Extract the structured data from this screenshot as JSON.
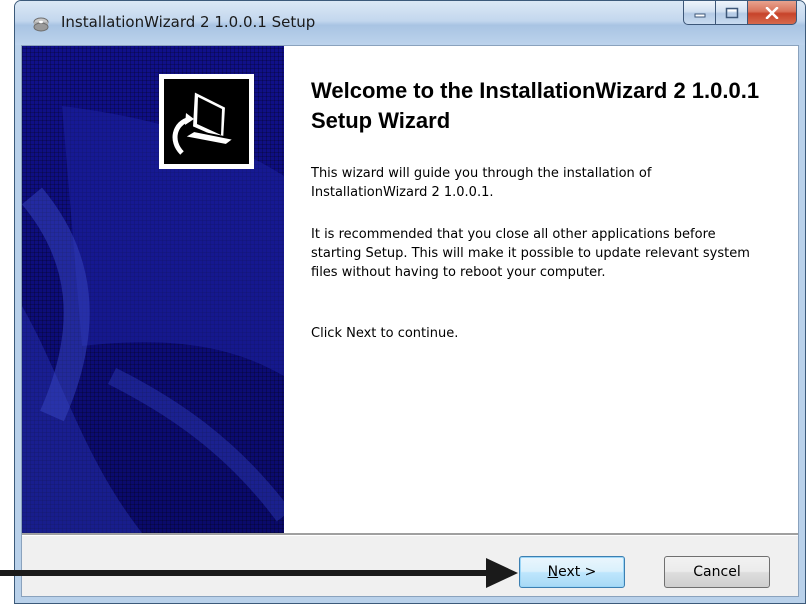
{
  "window": {
    "title": "InstallationWizard 2 1.0.0.1 Setup",
    "icon": "installer-disc-icon",
    "caption_buttons": [
      "minimize-icon",
      "maximize-icon",
      "close-icon"
    ]
  },
  "sidebar": {
    "logo": "installer-computer-icon"
  },
  "main": {
    "heading": "Welcome to the InstallationWizard 2 1.0.0.1 Setup Wizard",
    "paragraph_1": "This wizard will guide you through the installation of InstallationWizard 2 1.0.0.1.",
    "paragraph_2": "It is recommended that you close all other applications before starting Setup. This will make it possible to update relevant system files without having to reboot your computer.",
    "paragraph_3": "Click Next to continue."
  },
  "buttons": {
    "next_mnemonic": "N",
    "next_rest": "ext >",
    "cancel": "Cancel"
  },
  "annotation": {
    "icon": "pointer-arrow-icon"
  },
  "colors": {
    "sidebar_bg": "#0c0c78",
    "titlebar": "#c3d7ee",
    "close_button": "#c7432a",
    "default_button_border": "#3c7fb1"
  }
}
